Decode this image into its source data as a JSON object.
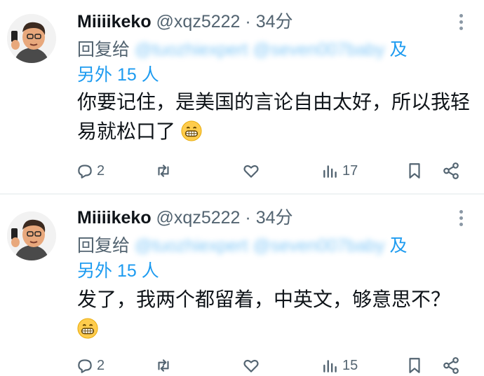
{
  "tweets": [
    {
      "name": "Miiiikeko",
      "handle": "@xqz5222",
      "separator": "·",
      "time": "34分",
      "reply_prefix": "回复给",
      "mention_blurred": "@tuozhiexpert @seven007baby",
      "reply_and": "及",
      "reply_others": "另外 15 人",
      "text": "你要记住，是美国的言论自由太好，所以我轻易就松口了",
      "emoji": "grinning-face-emoji",
      "replies": "2",
      "views": "17"
    },
    {
      "name": "Miiiikeko",
      "handle": "@xqz5222",
      "separator": "·",
      "time": "34分",
      "reply_prefix": "回复给",
      "mention_blurred": "@tuozhiexpert @seven007baby",
      "reply_and": "及",
      "reply_others": "另外 15 人",
      "text": "发了，我两个都留着，中英文，够意思不？",
      "emoji": "grinning-face-emoji",
      "replies": "2",
      "views": "15"
    }
  ],
  "colors": {
    "accent": "#1d9bf0",
    "muted": "#536471",
    "text": "#0f1419"
  }
}
